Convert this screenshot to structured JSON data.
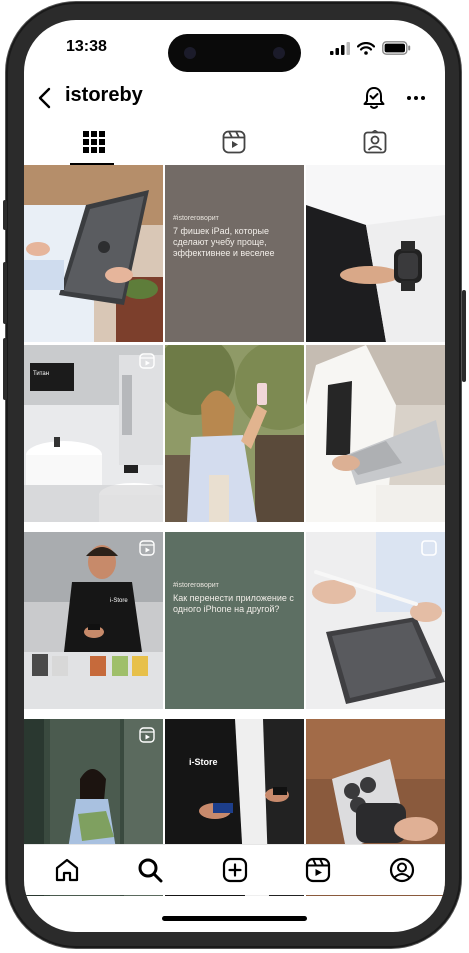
{
  "status_bar": {
    "time": "13:38"
  },
  "header": {
    "username": "istoreby"
  },
  "tabs": [
    "grid",
    "reels",
    "tagged"
  ],
  "posts": [
    {
      "id": "p1",
      "caption": "",
      "reel": false
    },
    {
      "id": "p2",
      "tag": "#istoreговорит",
      "caption": "7 фишек iPad, которые сделают учебу проще, эффективнее и веселее",
      "reel": false
    },
    {
      "id": "p3",
      "caption": "",
      "reel": false
    },
    {
      "id": "p4",
      "caption": "",
      "reel": true,
      "screen_text": "Титан"
    },
    {
      "id": "p5",
      "caption": "",
      "reel": false
    },
    {
      "id": "p6",
      "caption": "",
      "reel": false
    },
    {
      "id": "p7",
      "caption": "",
      "reel": true,
      "shirt_text": "i-Store"
    },
    {
      "id": "p8",
      "tag": "#istoreговорит",
      "caption": "Как перенести приложение с одного iPhone на другой?",
      "reel": false
    },
    {
      "id": "p9",
      "caption": "",
      "reel": false
    },
    {
      "id": "p10",
      "caption": "",
      "reel": true
    },
    {
      "id": "p11",
      "caption": "",
      "reel": false,
      "shirt_text": "i-Store"
    },
    {
      "id": "p12",
      "caption": "",
      "reel": false
    }
  ],
  "bottom_nav": [
    "home-icon",
    "search-icon",
    "create-icon",
    "reels-icon",
    "profile-icon"
  ],
  "colors": {
    "post2_bg": "#736b66",
    "post8_bg": "#5d6f63"
  }
}
